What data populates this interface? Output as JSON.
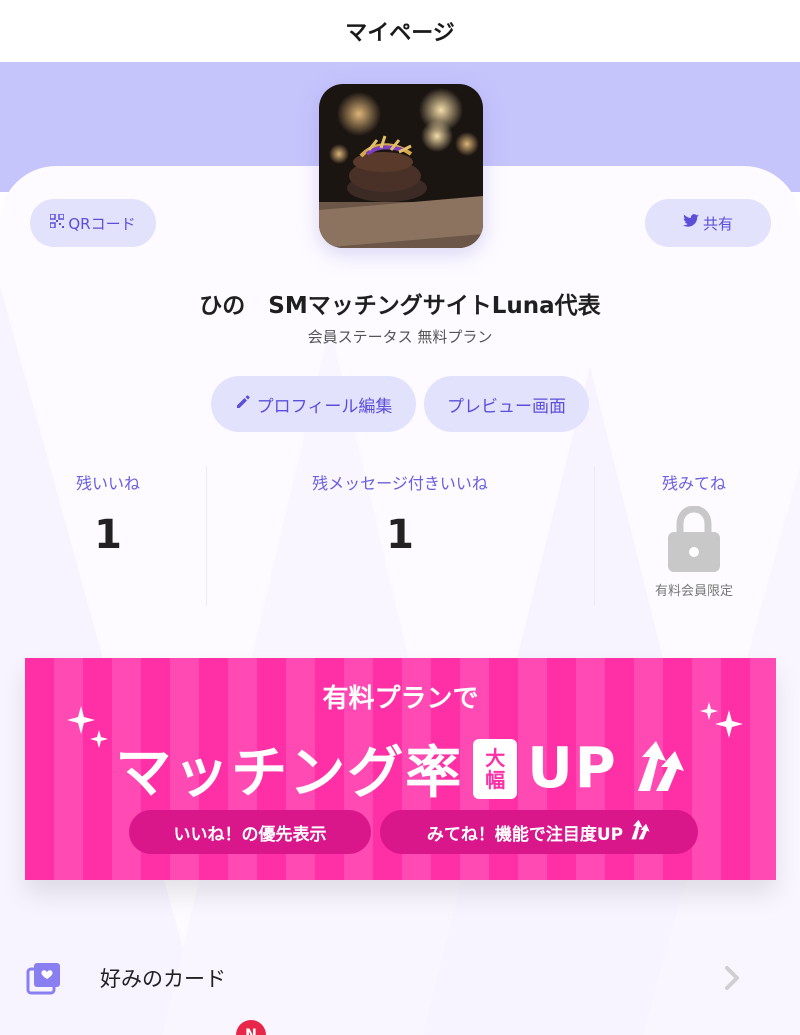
{
  "header": {
    "title": "マイページ"
  },
  "profile": {
    "qr_label": "QRコード",
    "share_label": "共有",
    "name": "ひの　SMマッチングサイトLuna代表",
    "status": "会員ステータス 無料プラン",
    "edit_label": "プロフィール編集",
    "preview_label": "プレビュー画面"
  },
  "stats": {
    "likes_label": "残いいね",
    "likes_value": "1",
    "message_likes_label": "残メッセージ付きいいね",
    "message_likes_value": "1",
    "mitene_label": "残みてね",
    "mitene_note": "有料会員限定"
  },
  "banner": {
    "line1": "有料プランで",
    "headline": "マッチング率",
    "badge_top": "大",
    "badge_bottom": "幅",
    "up": "UP",
    "chip1": "いいね！の優先表示",
    "chip2": "みてね！機能で注目度UP"
  },
  "menu": {
    "favorite_cards": "好みのカード",
    "new_badge": "N"
  },
  "colors": {
    "accent": "#5b4fd9",
    "hero": "#c5c4fb",
    "pill_bg": "#e3e2fd",
    "banner_pink": "#ff2fa6"
  }
}
